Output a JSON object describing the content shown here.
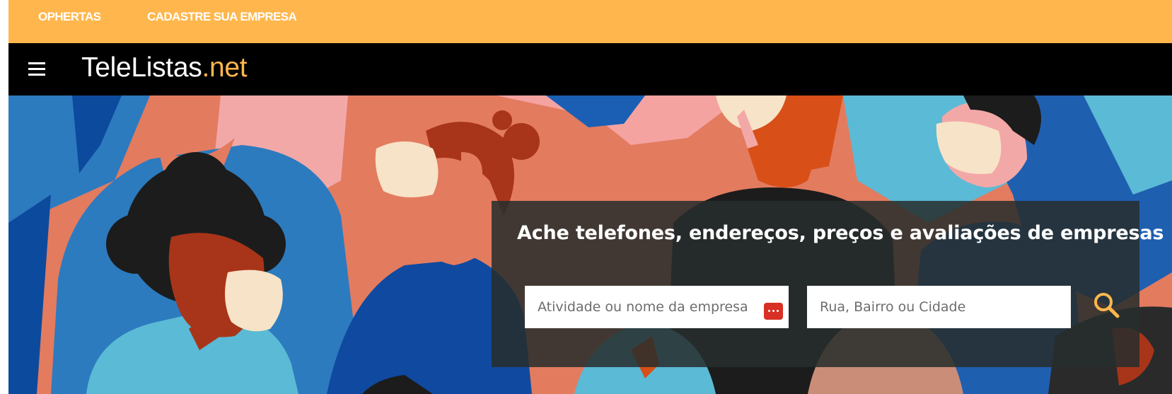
{
  "topbar": {
    "links": [
      "OPHERTAS",
      "CADASTRE SUA EMPRESA"
    ],
    "background": "#ffb74d"
  },
  "navbar": {
    "logo_main": "TeleListas",
    "logo_accent": ".net",
    "menu_icon": "hamburger-menu-icon",
    "accent_color": "#ffb74d"
  },
  "search": {
    "headline": "Ache telefones, endereços, preços e avaliações de empresas",
    "activity_placeholder": "Atividade ou nome da empresa",
    "location_placeholder": "Rua, Bairro ou Cidade",
    "activity_icon": "dots-menu-icon",
    "search_icon": "magnifier-icon"
  }
}
